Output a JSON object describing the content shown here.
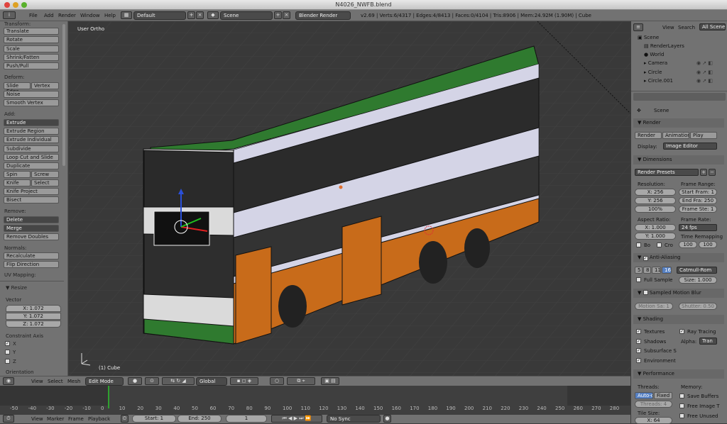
{
  "window": {
    "title": "N4026_NWFB.blend"
  },
  "menu": {
    "items": [
      "File",
      "Add",
      "Render",
      "Window",
      "Help"
    ],
    "layout": "Default",
    "scene": "Scene",
    "engine": "Blender Render"
  },
  "stats": "v2.69 | Verts:6/4317 | Edges:4/8413 | Faces:0/4104 | Tris:8906 | Mem:24.92M (1.90M) | Cube",
  "tools": {
    "transform_header": "Transform:",
    "transform": [
      "Translate",
      "Rotate",
      "Scale",
      "Shrink/Fatten",
      "Push/Pull"
    ],
    "deform_header": "Deform:",
    "deform_row": [
      "Slide Edge",
      "Vertex"
    ],
    "deform": [
      "Noise",
      "Smooth Vertex"
    ],
    "add_header": "Add:",
    "extrude": "Extrude",
    "add": [
      "Extrude Region",
      "Extrude Individual",
      "Subdivide",
      "Loop Cut and Slide",
      "Duplicate"
    ],
    "add_row1": [
      "Spin",
      "Screw"
    ],
    "add_row2": [
      "Knife",
      "Select"
    ],
    "add2": [
      "Knife Project",
      "Bisect"
    ],
    "remove_header": "Remove:",
    "delete": "Delete",
    "merge": "Merge",
    "remove_doubles": "Remove Doubles",
    "normals_header": "Normals:",
    "normals": [
      "Recalculate",
      "Flip Direction"
    ],
    "uv_header": "UV Mapping:",
    "resize_header": "Resize",
    "vector_label": "Vector",
    "vector": [
      "X: 1.072",
      "Y: 1.072",
      "Z: 1.072"
    ],
    "constraint_label": "Constraint Axis",
    "axes": [
      "X",
      "Y",
      "Z"
    ],
    "orientation_label": "Orientation"
  },
  "viewport": {
    "view_label": "User Ortho",
    "object_label": "(1) Cube"
  },
  "outliner": {
    "tabs": [
      "View",
      "Search",
      "All Scenes"
    ],
    "items": [
      "Scene",
      "RenderLayers",
      "World",
      "Camera",
      "Circle",
      "Circle.001"
    ]
  },
  "properties": {
    "context": "Scene",
    "render_header": "Render",
    "render_buttons": [
      "Render",
      "Animation",
      "Play"
    ],
    "display_label": "Display:",
    "display_value": "Image Editor",
    "dimensions_header": "Dimensions",
    "render_presets": "Render Presets",
    "resolution_label": "Resolution:",
    "res_x": "X: 256",
    "res_y": "Y: 256",
    "res_pct": "100%",
    "frame_range_label": "Frame Range:",
    "start_frame": "Start Fram: 1",
    "end_frame": "End Fra: 250",
    "frame_step": "Frame Ste: 1",
    "aspect_label": "Aspect Ratio:",
    "aspect_x": "X: 1.000",
    "aspect_y": "Y: 1.000",
    "frame_rate_label": "Frame Rate:",
    "fps": "24 fps",
    "time_remap_label": "Time Remapping",
    "remap_old": "100",
    "remap_new": "100",
    "border_label": "Bo",
    "crop_label": "Cro",
    "aa_header": "Anti-Aliasing",
    "aa_samples": [
      "5",
      "8",
      "11",
      "16"
    ],
    "aa_filter": "Catmull-Rom",
    "full_sample": "Full Sample",
    "aa_size": "Size: 1.000",
    "motion_header": "Sampled Motion Blur",
    "motion_samples": "Motion Sa: 1",
    "shutter": "Shutter: 0.50",
    "shading_header": "Shading",
    "textures": "Textures",
    "ray_tracing": "Ray Tracing",
    "shadows": "Shadows",
    "alpha_label": "Alpha:",
    "alpha_value": "Tran",
    "sss": "Subsurface S",
    "environment": "Environment",
    "perf_header": "Performance",
    "threads_label": "Threads:",
    "threads_auto": "Auto-det",
    "threads_fixed": "Fixed",
    "threads_count": "Threads: 4",
    "memory_label": "Memory:",
    "save_buffers": "Save Buffers",
    "free_image": "Free Image T",
    "free_unused": "Free Unused",
    "tile_label": "Tile Size:",
    "tile_x": "X: 64"
  },
  "view_header": {
    "items": [
      "View",
      "Select",
      "Mesh"
    ],
    "mode": "Edit Mode",
    "orientation": "Global"
  },
  "timeline": {
    "ticks": [
      "-50",
      "-40",
      "-30",
      "-20",
      "-10",
      "0",
      "10",
      "20",
      "30",
      "40",
      "50",
      "60",
      "70",
      "80",
      "90",
      "100",
      "110",
      "120",
      "130",
      "140",
      "150",
      "160",
      "170",
      "180",
      "190",
      "200",
      "210",
      "220",
      "230",
      "240",
      "250",
      "260",
      "270",
      "280"
    ],
    "menu": [
      "View",
      "Marker",
      "Frame",
      "Playback"
    ],
    "start": "Start: 1",
    "end": "End: 250",
    "current": "1",
    "sync": "No Sync"
  }
}
